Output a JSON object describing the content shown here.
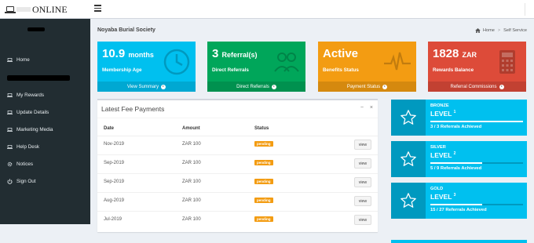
{
  "app": {
    "title": "ONLINE"
  },
  "sidebar": {
    "items": [
      {
        "label": "Home",
        "icon": "laptop-icon"
      },
      {
        "label": "My Rewards",
        "icon": "laptop-icon"
      },
      {
        "label": "Update Details",
        "icon": "laptop-icon"
      },
      {
        "label": "Marketing Media",
        "icon": "laptop-icon"
      },
      {
        "label": "Help Desk",
        "icon": "laptop-icon"
      },
      {
        "label": "Notices",
        "icon": "gear-icon"
      },
      {
        "label": "Sign Out",
        "icon": "power-icon"
      }
    ]
  },
  "header": {
    "page_title": "Noyaba Burial Society",
    "breadcrumb": {
      "home": "Home",
      "current": "Self Service"
    }
  },
  "stats": [
    {
      "value": "10.9",
      "unit": "months",
      "label": "Membership Age",
      "footer": "View Summary",
      "color": "#00c0ef",
      "icon": "clock-icon"
    },
    {
      "value": "3",
      "unit": "Referral(s)",
      "label": "Direct Referrals",
      "footer": "Direct Referrals",
      "color": "#00a65a",
      "icon": "users-icon"
    },
    {
      "value": "Active",
      "unit": "",
      "label": "Benefits Status",
      "footer": "Payment Status",
      "color": "#f39c12",
      "icon": "heartbeat-icon"
    },
    {
      "value": "1828",
      "unit": "ZAR",
      "label": "Rewards Balance",
      "footer": "Referral Commissions",
      "color": "#dd4b39",
      "icon": "calculator-icon"
    }
  ],
  "payments": {
    "title": "Latest Fee Payments",
    "columns": [
      "Date",
      "Amount",
      "Status"
    ],
    "rows": [
      {
        "date": "Nov-2019",
        "amount": "ZAR 100",
        "status": "pending",
        "action": "view"
      },
      {
        "date": "Sep-2019",
        "amount": "ZAR 100",
        "status": "pending",
        "action": "view"
      },
      {
        "date": "Sep-2019",
        "amount": "ZAR 100",
        "status": "pending",
        "action": "view"
      },
      {
        "date": "Aug-2019",
        "amount": "ZAR 100",
        "status": "pending",
        "action": "view"
      },
      {
        "date": "Jul-2019",
        "amount": "ZAR 100",
        "status": "pending",
        "action": "view"
      }
    ]
  },
  "levels": [
    {
      "tier": "BRONZE",
      "name": "LEVEL",
      "num": "1",
      "desc": "3 / 3 Referrals Achieved",
      "progress": 1.0
    },
    {
      "tier": "SILVER",
      "name": "LEVEL",
      "num": "2",
      "desc": "5 / 9 Referrals Achieved",
      "progress": 0.556
    },
    {
      "tier": "GOLD",
      "name": "LEVEL",
      "num": "3",
      "desc": "15 / 27 Referrals Achieved",
      "progress": 0.556
    }
  ],
  "colors": {
    "sidebar": "#222d32",
    "info": "#00c0ef",
    "success": "#00a65a",
    "warning": "#f39c12",
    "danger": "#dd4b39"
  }
}
